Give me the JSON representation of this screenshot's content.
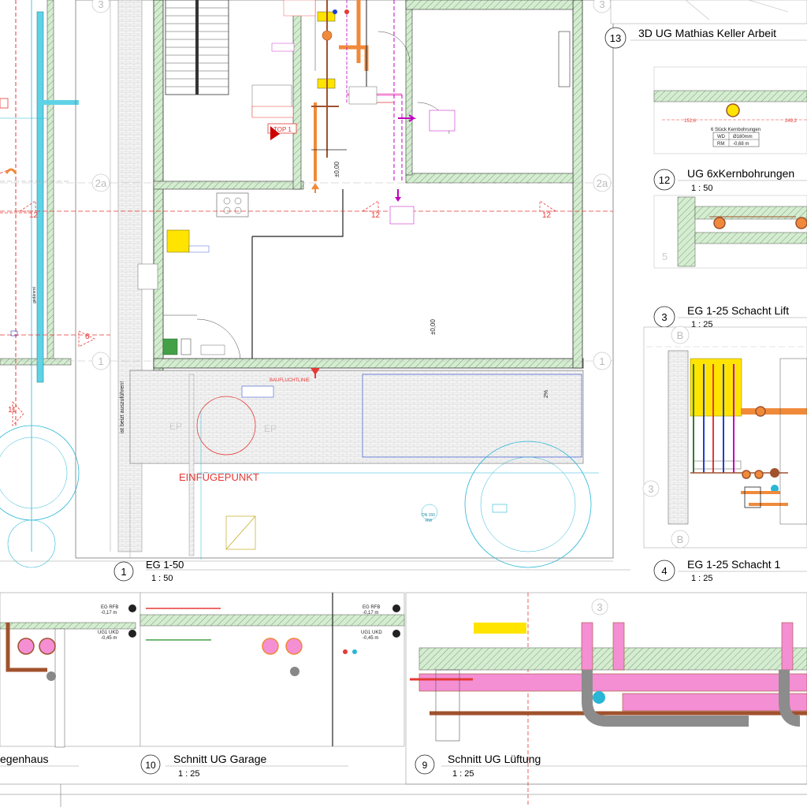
{
  "views": [
    {
      "num": "13",
      "title": "3D UG Mathias Keller Arbeit",
      "scale": ""
    },
    {
      "num": "12",
      "title": "UG 6xKernbohrungen",
      "scale": "1 : 50"
    },
    {
      "num": "3",
      "title": "EG 1-25 Schacht Lift",
      "scale": "1 : 25"
    },
    {
      "num": "4",
      "title": "EG 1-25 Schacht 1",
      "scale": "1 : 25"
    },
    {
      "num": "1",
      "title": "EG 1-50",
      "scale": "1 : 50"
    },
    {
      "num": "10",
      "title": "Schnitt UG  Garage",
      "scale": "1 : 25"
    },
    {
      "num": "9",
      "title": "Schnitt UG Lüftung",
      "scale": "1 : 25"
    },
    {
      "num": "",
      "title": "egenhaus",
      "scale": ""
    }
  ],
  "annotations": {
    "einfuegepunkt": "EINFÜGEPUNKT",
    "baufluchtlinie": "BAUFLUCHTLINIE",
    "top1": "TOP 1",
    "zero_level_a": "±0,00",
    "zero_level_b": "±0,00",
    "ug_ukd": "UG1 UKD",
    "eg_rfb": "EG RFB",
    "level_minus017": "-0,17 m",
    "level_minus045": "-0,45 m",
    "grid_1": "1",
    "grid_2a": "2a",
    "grid_3": "3",
    "grid_5": "5",
    "grid_b": "B",
    "grid_12": "12",
    "grid_6": "6",
    "grid_11": "11",
    "dn150": "DN 150",
    "rw": "RW",
    "kernbohrungen": "6 Stück Kernbohrungen",
    "wd": "WD",
    "rm": "RM",
    "wd_val": "Ø180mm",
    "rm_val": "-0,68 m",
    "dim_1526": "152,6",
    "dim_2492": "249,2",
    "pct2": "2%",
    "dachrinne": "ist beizt auszuführen!"
  },
  "colors": {
    "wall_green": "#c9e3c6",
    "hatch_green": "#2e7d32",
    "red": "#e53935",
    "pipe_brown": "#a0522d",
    "pipe_orange": "#f08a3a",
    "duct_pink": "#f48fd4",
    "duct_grey": "#8c8c8c",
    "cyan": "#29b6d6",
    "yellow": "#ffe400",
    "blue": "#1e3fd1",
    "magenta": "#c000c0"
  }
}
